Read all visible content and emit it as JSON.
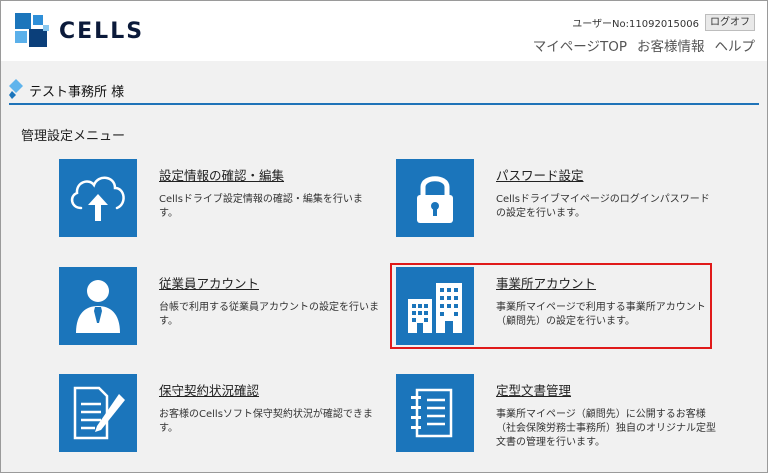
{
  "header": {
    "logo_text": "CELLS",
    "user_no": "ユーザーNo:11092015006",
    "logout_label": "ログオフ",
    "nav": [
      {
        "label": "マイページTOP"
      },
      {
        "label": "お客様情報"
      },
      {
        "label": "ヘルプ"
      }
    ]
  },
  "office": {
    "name": "テスト事務所 様"
  },
  "menu": {
    "title": "管理設定メニュー",
    "items": [
      {
        "title": "設定情報の確認・編集",
        "desc": "Cellsドライブ設定情報の確認・編集を行います。",
        "icon": "cloud-upload-icon"
      },
      {
        "title": "パスワード設定",
        "desc": "Cellsドライブマイページのログインパスワードの設定を行います。",
        "icon": "padlock-icon"
      },
      {
        "title": "従業員アカウント",
        "desc": "台帳で利用する従業員アカウントの設定を行います。",
        "icon": "employee-icon"
      },
      {
        "title": "事業所アカウント",
        "desc": "事業所マイページで利用する事業所アカウント（顧問先）の設定を行います。",
        "icon": "buildings-icon"
      },
      {
        "title": "保守契約状況確認",
        "desc": "お客様のCellsソフト保守契約状況が確認できます。",
        "icon": "document-pen-icon"
      },
      {
        "title": "定型文書管理",
        "desc": "事業所マイページ（顧問先）に公開するお客様（社会保険労務士事務所）独自のオリジナル定型文書の管理を行います。",
        "icon": "document-list-icon"
      }
    ]
  },
  "colors": {
    "icon_bg": "#1b75bb",
    "accent_line": "#1f73b8",
    "highlight": "#e01a1a"
  }
}
